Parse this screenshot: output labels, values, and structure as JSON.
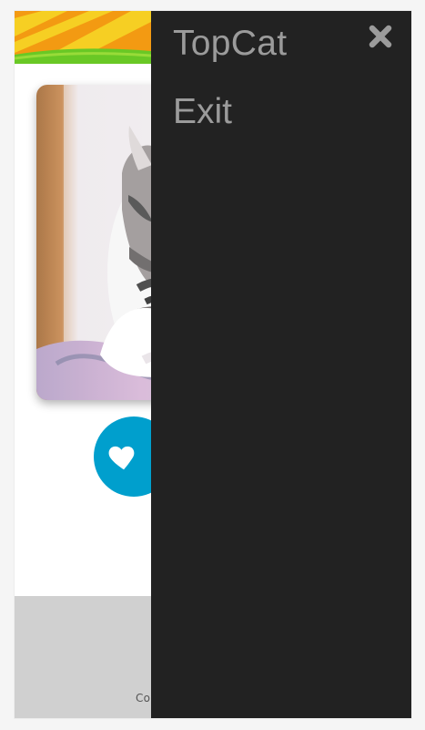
{
  "drawer": {
    "title": "TopCat",
    "close_icon": "close-icon",
    "menu": [
      {
        "label": "Exit"
      }
    ]
  },
  "main": {
    "like_icon": "heart-icon",
    "footer_text": "Co"
  },
  "colors": {
    "drawer_background": "#222222",
    "drawer_text": "#9b9b9b",
    "like_button": "#009fcd",
    "footer_background": "#d0d0d0",
    "banner_orange": "#f39a12",
    "banner_yellow": "#f6cf23",
    "banner_green": "#69c825"
  }
}
